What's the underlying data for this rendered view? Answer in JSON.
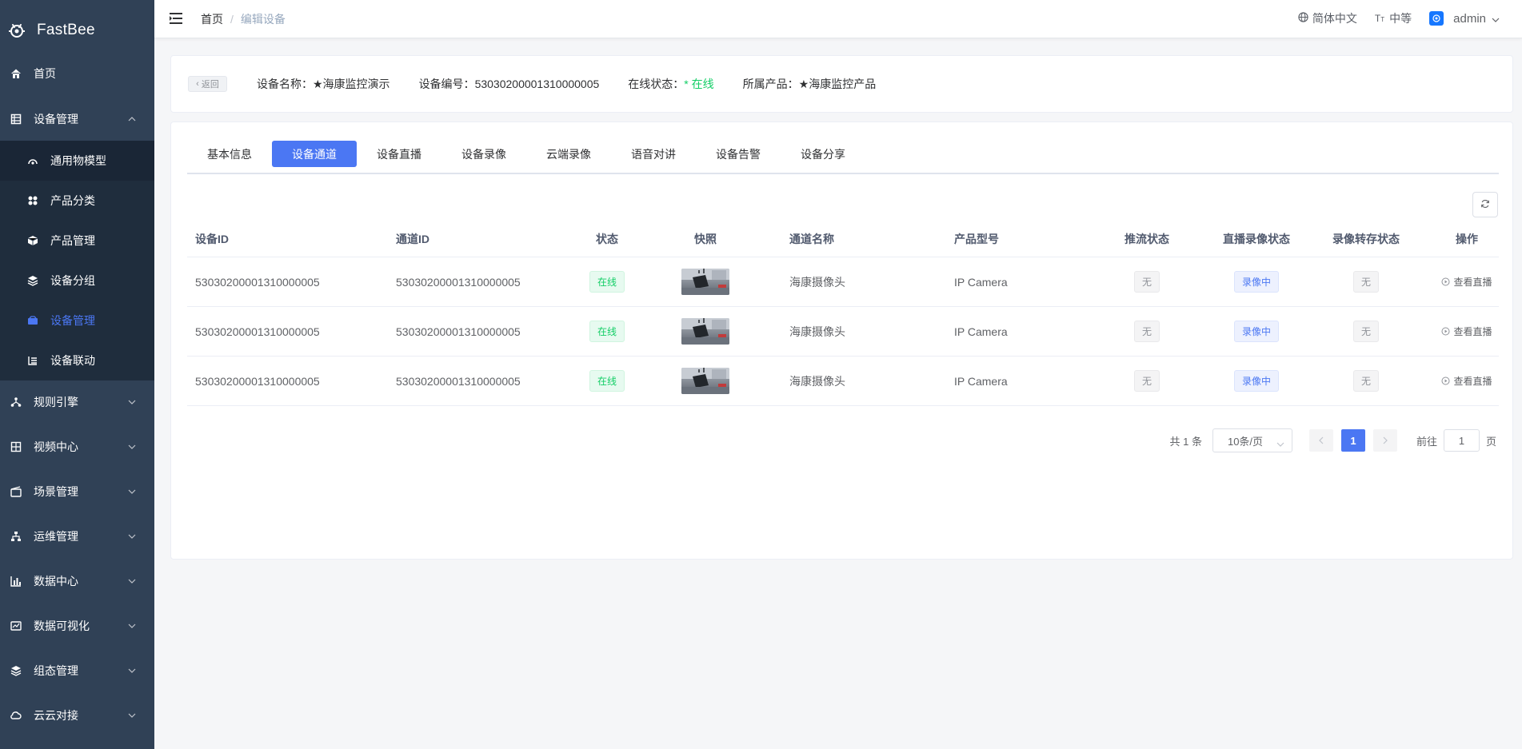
{
  "app": {
    "name": "FastBee"
  },
  "sidebar": {
    "items": [
      {
        "label": "首页",
        "icon": "home-icon"
      },
      {
        "label": "设备管理",
        "icon": "device-list-icon",
        "expanded": true
      },
      {
        "label": "规则引擎",
        "icon": "rule-engine-icon"
      },
      {
        "label": "视频中心",
        "icon": "video-icon"
      },
      {
        "label": "场景管理",
        "icon": "scene-icon"
      },
      {
        "label": "运维管理",
        "icon": "ops-icon"
      },
      {
        "label": "数据中心",
        "icon": "chart-icon"
      },
      {
        "label": "数据可视化",
        "icon": "visual-icon"
      },
      {
        "label": "组态管理",
        "icon": "layers-icon"
      },
      {
        "label": "云云对接",
        "icon": "cloud-icon"
      }
    ],
    "subitems": [
      {
        "label": "通用物模型",
        "icon": "model-icon"
      },
      {
        "label": "产品分类",
        "icon": "category-icon"
      },
      {
        "label": "产品管理",
        "icon": "cube-icon"
      },
      {
        "label": "设备分组",
        "icon": "group-icon"
      },
      {
        "label": "设备管理",
        "icon": "device-icon",
        "active": true
      },
      {
        "label": "设备联动",
        "icon": "linkage-icon"
      }
    ]
  },
  "header": {
    "breadcrumb": {
      "home": "首页",
      "separator": "/",
      "current": "编辑设备"
    },
    "language": "简体中文",
    "font_size": "中等",
    "user": "admin"
  },
  "device_info": {
    "back_label": "返回",
    "name_key": "设备名称：",
    "name_value": "★海康监控演示",
    "serial_key": "设备编号：",
    "serial_value": "53030200001310000005",
    "status_key": "在线状态：",
    "status_value": "* 在线",
    "product_key": "所属产品：",
    "product_value": "★海康监控产品"
  },
  "tabs": [
    "基本信息",
    "设备通道",
    "设备直播",
    "设备录像",
    "云端录像",
    "语音对讲",
    "设备告警",
    "设备分享"
  ],
  "active_tab": "设备通道",
  "table": {
    "columns": [
      "设备ID",
      "通道ID",
      "状态",
      "快照",
      "通道名称",
      "产品型号",
      "推流状态",
      "直播录像状态",
      "录像转存状态",
      "操作"
    ],
    "rows": [
      {
        "device_id": "53030200001310000005",
        "channel_id": "53030200001310000005",
        "status": "在线",
        "name": "海康摄像头",
        "model": "IP Camera",
        "push": "无",
        "live_record": "录像中",
        "transfer": "无",
        "action": "查看直播"
      },
      {
        "device_id": "53030200001310000005",
        "channel_id": "53030200001310000005",
        "status": "在线",
        "name": "海康摄像头",
        "model": "IP Camera",
        "push": "无",
        "live_record": "录像中",
        "transfer": "无",
        "action": "查看直播"
      },
      {
        "device_id": "53030200001310000005",
        "channel_id": "53030200001310000005",
        "status": "在线",
        "name": "海康摄像头",
        "model": "IP Camera",
        "push": "无",
        "live_record": "录像中",
        "transfer": "无",
        "action": "查看直播"
      }
    ]
  },
  "pagination": {
    "total": "共 1 条",
    "page_size": "10条/页",
    "current_page": "1",
    "goto_label": "前往",
    "goto_value": "1",
    "page_suffix": "页"
  },
  "colors": {
    "sidebar_bg": "#304156",
    "primary": "#4b77f3",
    "success": "#13ce66"
  }
}
